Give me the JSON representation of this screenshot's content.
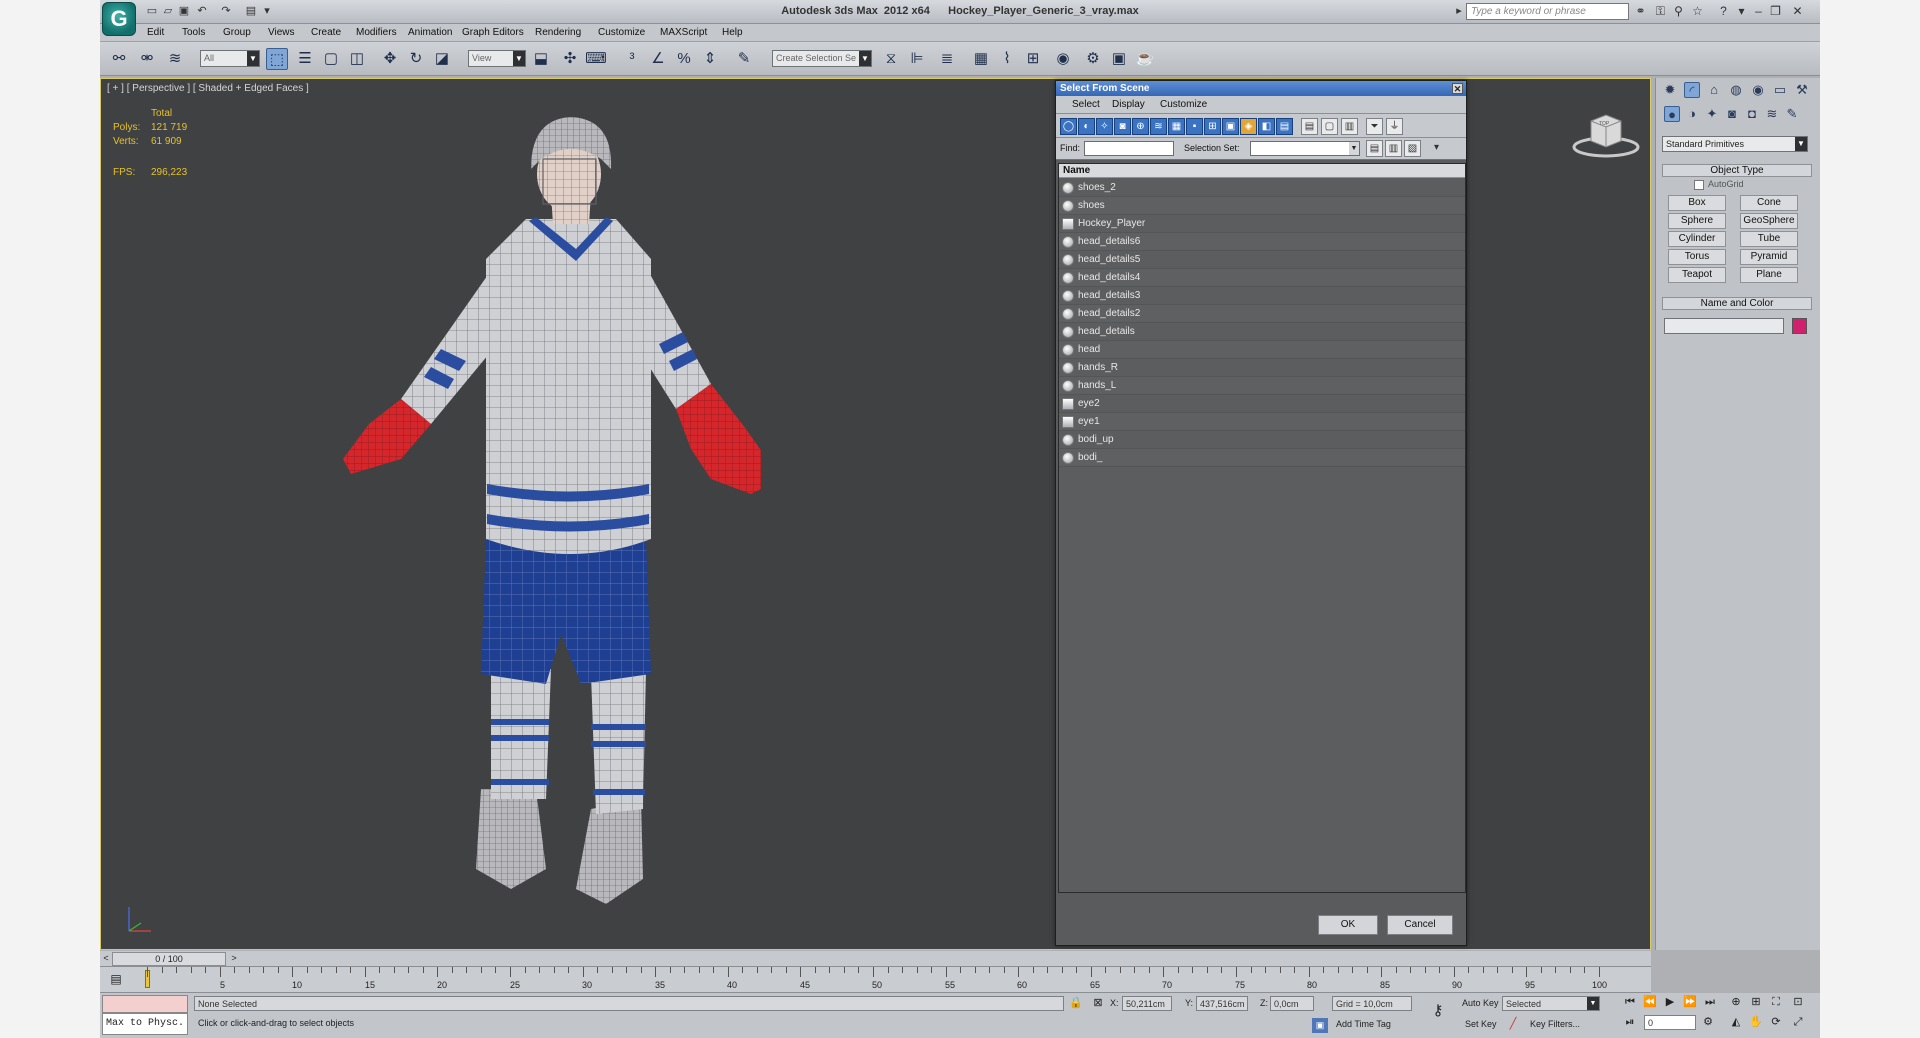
{
  "titlebar": {
    "title": "Autodesk 3ds Max  2012 x64      Hockey_Player_Generic_3_vray.max",
    "search_placeholder": "Type a keyword or phrase"
  },
  "menus": [
    "Edit",
    "Tools",
    "Group",
    "Views",
    "Create",
    "Modifiers",
    "Animation",
    "Graph Editors",
    "Rendering",
    "Customize",
    "MAXScript",
    "Help"
  ],
  "toolbar": {
    "filter_value": "All",
    "refcoord_value": "View",
    "selection_set_placeholder": "Create Selection Se"
  },
  "viewport": {
    "label": "[ + ] [ Perspective ] [ Shaded + Edged Faces ]",
    "stats_header": "Total",
    "polys_label": "Polys:",
    "polys_value": "121 719",
    "verts_label": "Verts:",
    "verts_value": "61 909",
    "fps_label": "FPS:",
    "fps_value": "296,223",
    "navcube_label": "TOP"
  },
  "dialog": {
    "title": "Select From Scene",
    "menu": [
      "Select",
      "Display",
      "Customize"
    ],
    "find_label": "Find:",
    "selection_set_label": "Selection Set:",
    "column_name": "Name",
    "items": [
      "shoes_2",
      "shoes",
      "Hockey_Player",
      "head_details6",
      "head_details5",
      "head_details4",
      "head_details3",
      "head_details2",
      "head_details",
      "head",
      "hands_R",
      "hands_L",
      "eye2",
      "eye1",
      "bodi_up",
      "bodi_"
    ],
    "ok": "OK",
    "cancel": "Cancel"
  },
  "command_panel": {
    "category_value": "Standard Primitives",
    "object_type_header": "Object Type",
    "autogrid_label": "AutoGrid",
    "buttons": [
      "Box",
      "Cone",
      "Sphere",
      "GeoSphere",
      "Cylinder",
      "Tube",
      "Torus",
      "Pyramid",
      "Teapot",
      "Plane"
    ],
    "name_color_header": "Name and Color",
    "object_color": "#d0206e"
  },
  "timeline": {
    "frame_counter": "0 / 100",
    "ticks": [
      "5",
      "10",
      "15",
      "20",
      "25",
      "30",
      "35",
      "40",
      "45",
      "50",
      "55",
      "60",
      "65",
      "70",
      "75",
      "80",
      "85",
      "90",
      "95",
      "100"
    ]
  },
  "status": {
    "maxscript_listener": "Max to Physc.",
    "selection_status": "None Selected",
    "prompt": "Click or click-and-drag to select objects",
    "x_label": "X:",
    "x_value": "50,211cm",
    "y_label": "Y:",
    "y_value": "437,516cm",
    "z_label": "Z:",
    "z_value": "0,0cm",
    "grid": "Grid = 10,0cm",
    "add_time_tag": "Add Time Tag",
    "auto_key": "Auto Key",
    "set_key": "Set Key",
    "key_mode_value": "Selected",
    "key_filters": "Key Filters...",
    "current_frame": "0"
  }
}
